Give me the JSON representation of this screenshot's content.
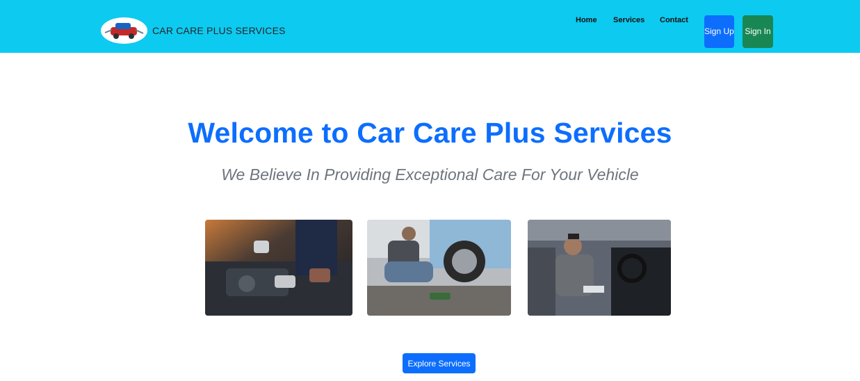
{
  "navbar": {
    "brand_text": "CAR CARE PLUS SERVICES",
    "links": [
      "Home",
      "Services",
      "Contact"
    ],
    "signup_label": "Sign Up",
    "signin_label": "Sign In"
  },
  "hero": {
    "title": "Welcome to Car Care Plus Services",
    "subtitle": "We Believe In Providing Exceptional Care For Your Vehicle",
    "explore_label": "Explore Services"
  },
  "colors": {
    "navbar_bg": "#0dcaf0",
    "primary": "#0d6efd",
    "success": "#198754",
    "muted": "#6c757d"
  },
  "images": [
    "engine-repair-photo",
    "tire-change-photo",
    "interior-inspection-photo"
  ]
}
